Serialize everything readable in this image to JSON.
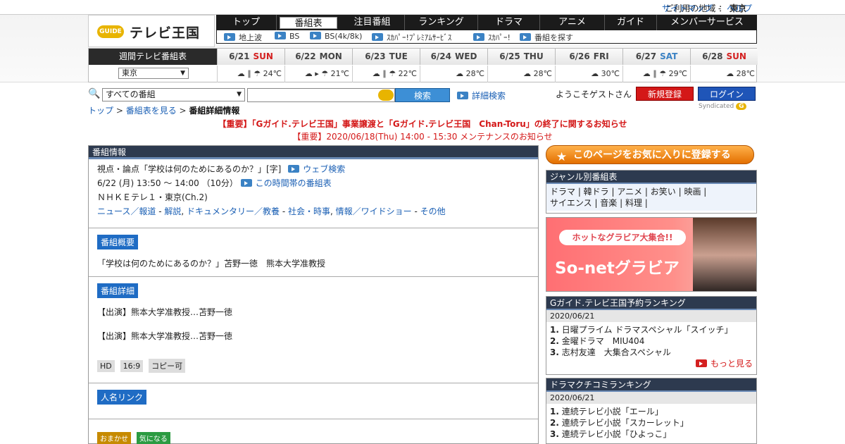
{
  "topbar": {
    "region_label": "ご利用の地域 ：",
    "region": "東京",
    "sitemap": "サイトマップ",
    "sep": "-",
    "help": "ヘルプ"
  },
  "logo": {
    "g": "GUIDE",
    "text": "テレビ王国"
  },
  "nav": [
    "トップ",
    "番組表",
    "注目番組",
    "ランキング",
    "ドラマ",
    "アニメ",
    "ガイド",
    "メンバーサービス"
  ],
  "subnav": [
    "地上波",
    "BS",
    "BS(4k/8k)",
    "ｽｶﾊﾟｰ!ﾌﾟﾚﾐｱﾑｻｰﾋﾞｽ",
    "ｽｶﾊﾟｰ!",
    "番組を探す"
  ],
  "week": {
    "label": "週間テレビ番組表",
    "region": "東京",
    "days": [
      {
        "d": "6/21",
        "w": "SUN",
        "cls": "sun",
        "wx": "☁ ∥ ☂ 24℃"
      },
      {
        "d": "6/22",
        "w": "MON",
        "cls": "",
        "wx": "☁ ▸ ☂ 21℃"
      },
      {
        "d": "6/23",
        "w": "TUE",
        "cls": "",
        "wx": "☁ ∥ ☂ 22℃"
      },
      {
        "d": "6/24",
        "w": "WED",
        "cls": "",
        "wx": "☁ 28℃"
      },
      {
        "d": "6/25",
        "w": "THU",
        "cls": "",
        "wx": "☁ 28℃"
      },
      {
        "d": "6/26",
        "w": "FRI",
        "cls": "",
        "wx": "☁ 30℃"
      },
      {
        "d": "6/27",
        "w": "SAT",
        "cls": "sat",
        "wx": "☁ ∥ ☂ 29℃"
      },
      {
        "d": "6/28",
        "w": "SUN",
        "cls": "sun",
        "wx": "☁ 28℃"
      }
    ]
  },
  "search": {
    "select": "すべての番組",
    "button": "検索",
    "advanced": "詳細検索",
    "welcome": "ようこそゲストさん",
    "register": "新規登録",
    "login": "ログイン"
  },
  "breadcrumb": {
    "top": "トップ",
    "sep1": " > ",
    "schedule": "番組表を見る",
    "sep2": " > ",
    "current": "番組詳細情報"
  },
  "syndicated": "Syndicated",
  "notices": [
    "【重要】「Gガイド.テレビ王国」事業譲渡と「Gガイド.テレビ王国　Chan-Toru」の終了に関するお知らせ",
    "【重要】2020/06/18(Thu) 14:00 - 15:30 メンテナンスのお知らせ"
  ],
  "program": {
    "section": "番組情報",
    "title": "視点・論点「学校は何のためにあるのか？」[字]",
    "web_search": "ウェブ検索",
    "time": "6/22 (月) 13:50 ～ 14:00 （10分）",
    "timeslot": "この時間帯の番組表",
    "channel": "ＮＨＫＥテレ１・東京(Ch.2)",
    "genres": [
      "ニュース／報道",
      "解説",
      "ドキュメンタリー／教養",
      "社会・時事",
      "情報／ワイドショー",
      "その他"
    ],
    "summary_tag": "番組概要",
    "summary": "「学校は何のためにあるのか？」苫野一徳　熊本大学准教授",
    "detail_tag": "番組詳細",
    "detail1": "【出演】熊本大学准教授…苫野一徳",
    "detail2": "【出演】熊本大学准教授…苫野一徳",
    "chips": [
      "HD",
      "16:9",
      "コピー可"
    ],
    "people_tag": "人名リンク",
    "omakase": "おまかせ",
    "kininaru": "気になる"
  },
  "side": {
    "fav": "このページをお気に入りに登録する",
    "genre_title": "ジャンル別番組表",
    "genre_line1": "ドラマ | 韓ドラ | アニメ | お笑い | 映画 |",
    "genre_line2": "サイエンス | 音楽 | 料理 |",
    "ad_pill": "ホットなグラビア大集合!!",
    "ad_text": "So-netグラビア",
    "rank_title": "Gガイド.テレビ王国予約ランキング",
    "rank_date": "2020/06/21",
    "rank": [
      "日曜プライム ドラマスペシャル「スイッチ」",
      "金曜ドラマ　MIU404",
      "志村友達　大集合スペシャル"
    ],
    "more": "もっと見る",
    "kuchi_title": "ドラマクチコミランキング",
    "kuchi_date": "2020/06/21",
    "kuchi": [
      "連続テレビ小説「エール」",
      "連続テレビ小説「スカーレット」",
      "連続テレビ小説「ひよっこ」"
    ]
  }
}
